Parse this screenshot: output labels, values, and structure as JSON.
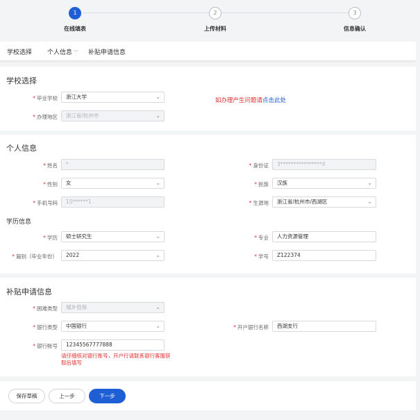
{
  "steps": [
    {
      "number": "1",
      "label": "在线填表",
      "active": true
    },
    {
      "number": "2",
      "label": "上传材料",
      "active": false
    },
    {
      "number": "3",
      "label": "信息确认",
      "active": false
    }
  ],
  "tabs": [
    {
      "label": "学校选择"
    },
    {
      "label": "个人信息",
      "chevron": "﹀"
    },
    {
      "label": "补贴申请信息"
    }
  ],
  "school": {
    "title": "学校选择",
    "graduate_school": {
      "label": "毕业学校",
      "value": "浙江大学"
    },
    "region": {
      "label": "办理地区",
      "value": "浙江省/杭州市"
    },
    "help": {
      "text_red": "如办理产生问题请",
      "text_blue": "点击此处"
    }
  },
  "personal": {
    "title": "个人信息",
    "name": {
      "label": "姓名",
      "value": "*"
    },
    "id_card": {
      "label": "身份证",
      "value": "3****************X"
    },
    "gender": {
      "label": "性别",
      "value": "女"
    },
    "ethnicity": {
      "label": "民族",
      "value": "汉族"
    },
    "phone": {
      "label": "手机号码",
      "value": "15******1"
    },
    "origin": {
      "label": "生源地",
      "value": "浙江省/杭州市/西湖区"
    },
    "education_title": "学历信息",
    "degree": {
      "label": "学历",
      "value": "硕士研究生"
    },
    "major": {
      "label": "专业",
      "value": "人力资源管理"
    },
    "graduation_year": {
      "label": "届别（毕业年份）",
      "value": "2022"
    },
    "student_id": {
      "label": "学号",
      "value": "Z122374"
    }
  },
  "subsidy": {
    "title": "补贴申请信息",
    "hardship_type": {
      "label": "困难类型",
      "value": "城乡低保"
    },
    "bank_type": {
      "label": "银行类型",
      "value": "中国银行"
    },
    "branch_name": {
      "label": "开户银行名称",
      "value": "西湖支行"
    },
    "account_number": {
      "label": "银行帐号",
      "value": "12345567777888"
    },
    "hint": "请仔细核对银行账号，开户行请联系银行客服获取后填写"
  },
  "buttons": {
    "save_draft": "保存草稿",
    "prev": "上一步",
    "next": "下一步"
  },
  "colors": {
    "primary": "#1f5fd6",
    "required": "#e23030"
  }
}
